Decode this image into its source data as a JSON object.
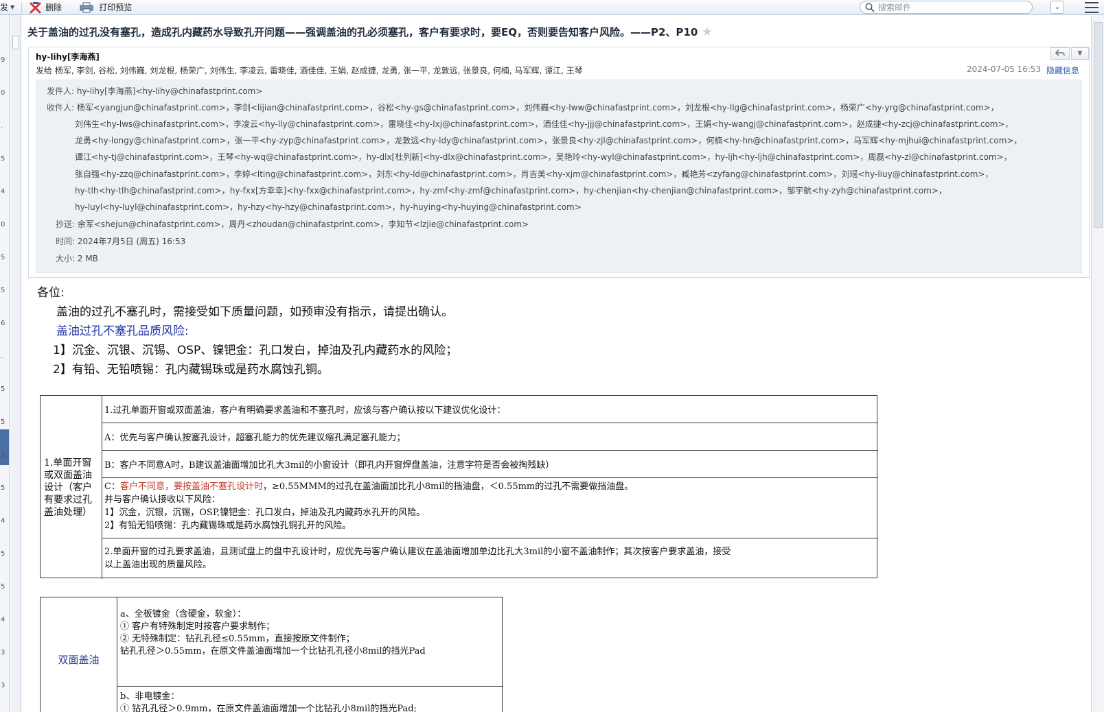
{
  "toolbar": {
    "reply_label": "发",
    "delete_label": "删除",
    "print_label": "打印预览",
    "search_placeholder": "搜索邮件"
  },
  "left_ticks": [
    "9",
    "0",
    ".",
    "5",
    "4",
    "0",
    "5",
    "5",
    "6",
    ".",
    "5",
    "5",
    "3",
    "5",
    "4",
    "5",
    "5",
    "4",
    "3",
    "3",
    "3"
  ],
  "mail": {
    "subject": "关于盖油的过孔没有塞孔，造成孔内藏药水导致孔开问题——强调盖油的孔必须塞孔，客户有要求时，要EQ，否则要告知客户风险。——P2、P10",
    "sender": "hy-lihy[李海燕]",
    "sendto": "发给 杨军, 李剑, 谷松, 刘伟巍, 刘龙根, 杨荣广, 刘伟生, 李凌云, 雷晓佳, 酒佳佳, 王娟, 赵成捷, 龙勇, 张一平, 龙敦远, 张景良, 何楠, 马军辉, 谭江, 王琴",
    "datetime": "2024-07-05 16:53",
    "hide_info": "隐藏信息",
    "details": {
      "from_label": "发件人:",
      "from": "hy-lihy[李海燕]<hy-lihy@chinafastprint.com>",
      "to_label": "收件人:",
      "to_lines": [
        "杨军<yangjun@chinafastprint.com>，李剑<lijian@chinafastprint.com>，谷松<hy-gs@chinafastprint.com>，刘伟巍<hy-lww@chinafastprint.com>，刘龙根<hy-llg@chinafastprint.com>，杨荣广<hy-yrg@chinafastprint.com>，",
        "刘伟生<hy-lws@chinafastprint.com>，李凌云<hy-lly@chinafastprint.com>，雷晓佳<hy-lxj@chinafastprint.com>，酒佳佳<hy-jjj@chinafastprint.com>，王娟<hy-wangj@chinafastprint.com>，赵成捷<hy-zcj@chinafastprint.com>，",
        "龙勇<hy-longy@chinafastprint.com>，张一平<hy-zyp@chinafastprint.com>，龙敦远<hy-ldy@chinafastprint.com>，张景良<hy-zjl@chinafastprint.com>，何楠<hy-hn@chinafastprint.com>，马军辉<hy-mjhui@chinafastprint.com>，",
        "谭江<hy-tj@chinafastprint.com>，王琴<hy-wq@chinafastprint.com>，hy-dlx[杜列新]<hy-dlx@chinafastprint.com>，吴艳玲<hy-wyl@chinafastprint.com>，hy-ljh<hy-ljh@chinafastprint.com>，周磊<hy-zl@chinafastprint.com>，",
        "张自强<hy-zzq@chinafastprint.com>，李婷<lting@chinafastprint.com>，刘东<hy-ld@chinafastprint.com>，肖吉美<hy-xjm@chinafastprint.com>，臧艳芳<zyfang@chinafastprint.com>，刘瑶<hy-liuy@chinafastprint.com>，",
        "hy-tlh<hy-tlh@chinafastprint.com>，hy-fxx[方幸幸]<hy-fxx@chinafastprint.com>，hy-zmf<hy-zmf@chinafastprint.com>，hy-chenjian<hy-chenjian@chinafastprint.com>，邹宇航<hy-zyh@chinafastprint.com>，",
        "hy-luyl<hy-luyl@chinafastprint.com>，hy-hzy<hy-hzy@chinafastprint.com>，hy-huying<hy-huying@chinafastprint.com>"
      ],
      "cc_label": "抄送:",
      "cc": "余军<shejun@chinafastprint.com>，周丹<zhoudan@chinafastprint.com>，李知节<lzjie@chinafastprint.com>",
      "time_label": "时间:",
      "time": "2024年7月5日 (周五) 16:53",
      "size_label": "大小:",
      "size": "2 MB"
    }
  },
  "body": {
    "greeting": "各位:",
    "line1": "盖油的过孔不塞孔时，需接受如下质量问题，如预审没有指示，请提出确认。",
    "risk_title": "盖油过孔不塞孔品质风险:",
    "risk1": "1】沉金、沉银、沉锡、OSP、镍钯金：孔口发白，掉油及孔内藏药水的风险；",
    "risk2": "2】有铅、无铅喷锡：孔内藏锡珠或是药水腐蚀孔铜。"
  },
  "table1": {
    "left_label": "1.单面开窗或双面盖油设计（客户有要求过孔盖油处理）",
    "r1": "1.过孔单面开窗或双面盖油，客户有明确要求盖油和不塞孔时，应该与客户确认按以下建议优化设计：",
    "r2": "A：优先与客户确认按塞孔设计，超塞孔能力的优先建议缩孔满足塞孔能力；",
    "r3": "B：客户不同意A时，B建议盖油面增加比孔大3mil的小窗设计（即孔内开窗焊盘盖油，注意字符是否会被掏残缺）",
    "r4_prefix": "C：",
    "r4_red": "客户不同意，要按盖油不塞孔设计时",
    "r4_rest": "，≥0.55MMM的过孔在盖油面加比孔小8mil的挡油盘，＜0.55mm的过孔不需要做挡油盘。",
    "r4_l2": "并与客户确认接收以下风险：",
    "r4_l3": "1】沉金，沉银，沉锡，OSP,镍钯金：孔口发白，掉油及孔内藏药水孔开的风险。",
    "r4_l4": "2】有铅无铅喷锡：孔内藏锡珠或是药水腐蚀孔铜孔开的风险。",
    "r5_l1": "2.单面开窗的过孔要求盖油，且测试盘上的盘中孔设计时，应优先与客户确认建议在盖油面增加单边比孔大3mil的小窗不盖油制作；其次按客户要求盖油，接受",
    "r5_l2": "以上盖油出现的质量风险。"
  },
  "table2": {
    "left_label": "双面盖油",
    "a1": "a、全板镀金（含硬金，软金）：",
    "a2": "① 客户有特殊制定时按客户要求制作；",
    "a3": "② 无特殊制定：钻孔孔径≤0.55mm，直接按原文件制作；",
    "a4": "   钻孔孔径＞0.55mm，在原文件盖油面增加一个比钻孔孔径小8mil的挡光Pad",
    "b1": "b、非电镀金：",
    "b2": "① 钻孔孔径＞0.9mm，在原文件盖油面增加一个比钻孔小8mil的挡光Pad;"
  }
}
